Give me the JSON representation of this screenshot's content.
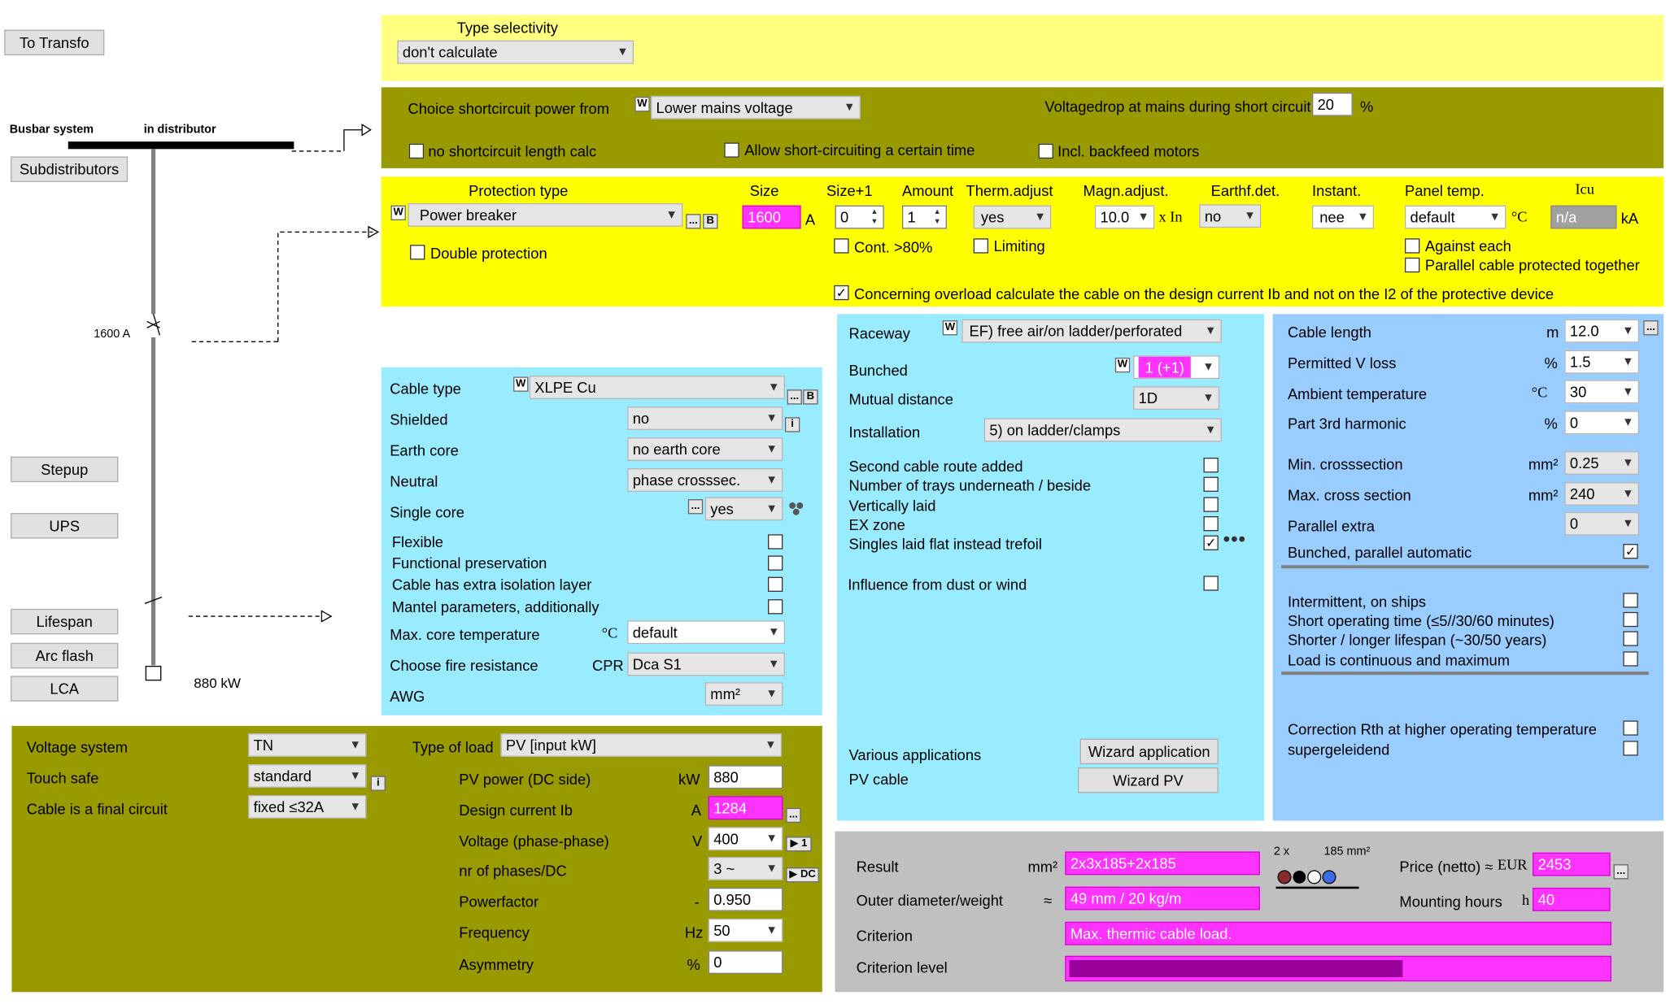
{
  "left": {
    "to_transfo": "To Transfo",
    "busbar": "Busbar system",
    "in_dist": "in distributor",
    "subdist": "Subdistributors",
    "breaker_amp": "1600 A",
    "stepup": "Stepup",
    "ups": "UPS",
    "lifespan": "Lifespan",
    "arc_flash": "Arc flash",
    "lca": "LCA",
    "load_kw": "880 kW"
  },
  "sel": {
    "title": "Type selectivity",
    "value": "don't calculate"
  },
  "sc": {
    "choice_label": "Choice shortcircuit power from",
    "choice_value": "Lower mains voltage",
    "vdrop_label": "Voltagedrop at mains during short circuit",
    "vdrop_value": "20",
    "vdrop_unit": "%",
    "no_sc": "no shortcircuit length calc",
    "allow_sc": "Allow short-circuiting a certain time",
    "backfeed": "Incl. backfeed motors",
    "w": "W"
  },
  "prot": {
    "h_type": "Protection type",
    "h_size": "Size",
    "h_size1": "Size+1",
    "h_amount": "Amount",
    "h_therm": "Therm.adjust",
    "h_magn": "Magn.adjust.",
    "h_earth": "Earthf.det.",
    "h_inst": "Instant.",
    "h_panel": "Panel temp.",
    "h_icu": "Icu",
    "type_value": "Power breaker",
    "dots": "...",
    "b": "B",
    "size": "1600",
    "size_unit": "A",
    "size1": "0",
    "amount": "1",
    "therm": "yes",
    "magn": "10.0",
    "magn_unit": "x In",
    "earth": "no",
    "inst": "nee",
    "panel": "default",
    "panel_unit": "°C",
    "icu": "n/a",
    "icu_unit": "kA",
    "double": "Double protection",
    "cont80": "Cont. >80%",
    "limiting": "Limiting",
    "against": "Against each",
    "parallel_prot": "Parallel cable protected together",
    "overload": "Concerning overload calculate the cable on the design current Ib and not on the I2 of the protective device"
  },
  "cable": {
    "type_label": "Cable type",
    "type_value": "XLPE Cu",
    "shielded_label": "Shielded",
    "shielded_value": "no",
    "earth_label": "Earth core",
    "earth_value": "no earth core",
    "neutral_label": "Neutral",
    "neutral_value": "phase crosssec.",
    "single_label": "Single core",
    "single_value": "yes",
    "flexible": "Flexible",
    "functional": "Functional preservation",
    "extra_iso": "Cable has extra isolation layer",
    "mantel": "Mantel parameters, additionally",
    "maxcore_label": "Max. core temperature",
    "maxcore_unit": "°C",
    "maxcore_value": "default",
    "fire_label": "Choose fire resistance",
    "fire_unit": "CPR",
    "fire_value": "Dca S1",
    "awg_label": "AWG",
    "awg_value": "mm²",
    "i": "i"
  },
  "race": {
    "raceway_label": "Raceway",
    "raceway_value": "EF) free air/on ladder/perforated",
    "bunched_label": "Bunched",
    "bunched_value": "1 (+1)",
    "mutual_label": "Mutual distance",
    "mutual_value": "1D",
    "install_label": "Installation",
    "install_value": "5) on ladder/clamps",
    "second_route": "Second cable route added",
    "trays": "Number of trays underneath / beside",
    "vertical": "Vertically laid",
    "ex_zone": "EX zone",
    "singles_flat": "Singles laid flat instead trefoil",
    "dust": "Influence from dust or wind",
    "various": "Various applications",
    "pv_cable": "PV cable",
    "wiz_app": "Wizard application",
    "wiz_pv": "Wizard PV"
  },
  "env": {
    "length_label": "Cable length",
    "length_unit": "m",
    "length_value": "12.0",
    "vloss_label": "Permitted V loss",
    "vloss_unit": "%",
    "vloss_value": "1.5",
    "ambient_label": "Ambient temperature",
    "ambient_unit": "°C",
    "ambient_value": "30",
    "harm_label": "Part 3rd harmonic",
    "harm_unit": "%",
    "harm_value": "0",
    "mincs_label": "Min. crosssection",
    "mincs_unit": "mm²",
    "mincs_value": "0.25",
    "maxcs_label": "Max. cross section",
    "maxcs_unit": "mm²",
    "maxcs_value": "240",
    "parallel_label": "Parallel extra",
    "parallel_value": "0",
    "bunched_auto": "Bunched, parallel automatic",
    "intermittent": "Intermittent, on ships",
    "short_op": "Short operating time (≤5//30/60 minutes)",
    "lifespan": "Shorter / longer lifespan (~30/50 years)",
    "continuous": "Load is continuous and maximum",
    "correction": "Correction Rth at higher operating temperature",
    "superg": "supergeleidend"
  },
  "load": {
    "vsys_label": "Voltage system",
    "vsys_value": "TN",
    "touch_label": "Touch safe",
    "touch_value": "standard",
    "final_label": "Cable is a final circuit",
    "final_value": "fixed ≤32A",
    "type_label": "Type of load",
    "type_value": "PV [input kW]",
    "pv_label": "PV power (DC side)",
    "pv_unit": "kW",
    "pv_value": "880",
    "ib_label": "Design current Ib",
    "ib_unit": "A",
    "ib_value": "1284",
    "volt_label": "Voltage (phase-phase)",
    "volt_unit": "V",
    "volt_value": "400",
    "phases_label": "nr of phases/DC",
    "phases_value": "3 ~",
    "pf_label": "Powerfactor",
    "pf_unit": "-",
    "pf_value": "0.950",
    "freq_label": "Frequency",
    "freq_unit": "Hz",
    "freq_value": "50",
    "asym_label": "Asymmetry",
    "asym_unit": "%",
    "asym_value": "0",
    "btn1": "▶ 1",
    "btndc": "▶ DC"
  },
  "result": {
    "result_label": "Result",
    "result_unit": "mm²",
    "result_value": "2x3x185+2x185",
    "od_label": "Outer diameter/weight",
    "od_unit": "≈",
    "od_value": "49 mm / 20 kg/m",
    "crit_label": "Criterion",
    "crit_value": "Max. thermic cable load.",
    "level_label": "Criterion level",
    "level_fraction": 0.62,
    "icon_mult": "2 x",
    "icon_cs": "185 mm²",
    "price_label": "Price (netto) ≈",
    "price_unit": "EUR",
    "price_value": "2453",
    "hours_label": "Mounting hours",
    "hours_unit": "h",
    "hours_value": "40"
  }
}
